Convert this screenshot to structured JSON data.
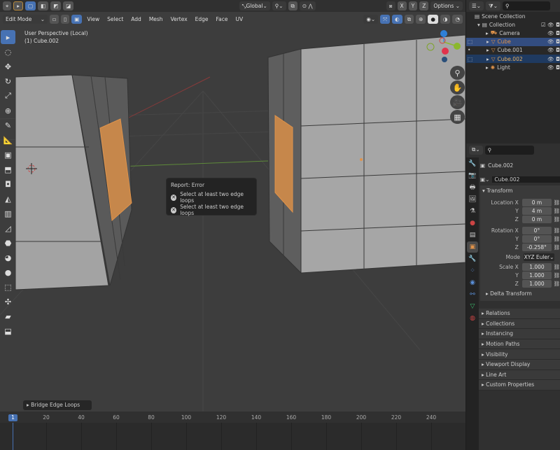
{
  "header": {
    "mode": "Edit Mode",
    "menus": [
      "View",
      "Select",
      "Add",
      "Mesh",
      "Vertex",
      "Edge",
      "Face",
      "UV"
    ],
    "orientation": "Global",
    "axes": [
      "X",
      "Y",
      "Z"
    ],
    "options": "Options"
  },
  "viewport": {
    "perspective": "User Perspective (Local)",
    "object": "(1) Cube.002"
  },
  "report": {
    "title": "Report: Error",
    "messages": [
      "Select at least two edge loops",
      "Select at least two edge loops"
    ]
  },
  "operator_panel": "Bridge Edge Loops",
  "outliner": {
    "scene": "Scene Collection",
    "collection": "Collection",
    "items": [
      {
        "name": "Camera",
        "icon": "camera-icon"
      },
      {
        "name": "Cube",
        "icon": "mesh-icon"
      },
      {
        "name": "Cube.001",
        "icon": "mesh-icon"
      },
      {
        "name": "Cube.002",
        "icon": "mesh-icon"
      },
      {
        "name": "Light",
        "icon": "light-icon"
      }
    ]
  },
  "properties": {
    "object_name": "Cube.002",
    "data_name": "Cube.002",
    "transform_label": "Transform",
    "location": {
      "label": "Location X",
      "x": "0 m",
      "y": "4 m",
      "z": "0 m"
    },
    "rotation": {
      "label": "Rotation X",
      "x": "0°",
      "y": "0°",
      "z": "-0.258°"
    },
    "mode": {
      "label": "Mode",
      "value": "XYZ Euler"
    },
    "scale": {
      "label": "Scale X",
      "x": "1.000",
      "y": "1.000",
      "z": "1.000"
    },
    "ylabel": "Y",
    "zlabel": "Z",
    "delta": "Delta Transform",
    "sections": [
      "Relations",
      "Collections",
      "Instancing",
      "Motion Paths",
      "Visibility",
      "Viewport Display",
      "Line Art",
      "Custom Properties"
    ]
  },
  "timeline": {
    "current_frame": "1",
    "ticks": [
      "20",
      "40",
      "60",
      "80",
      "100",
      "120",
      "140",
      "160",
      "180",
      "200",
      "220",
      "240"
    ]
  },
  "colors": {
    "accent": "#4772b3",
    "selected_face": "#e0934a"
  }
}
